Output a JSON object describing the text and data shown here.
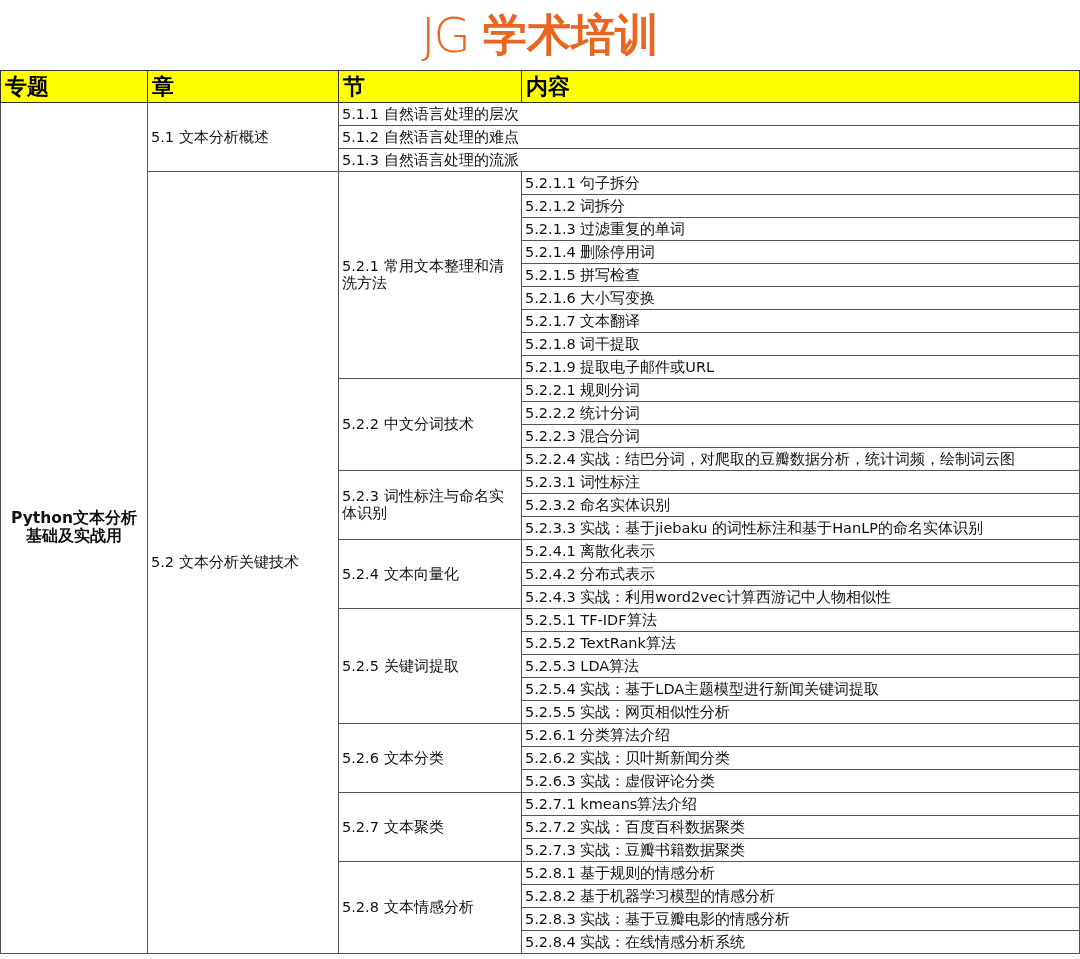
{
  "logo": {
    "mark": "JG",
    "text": "学术培训"
  },
  "table": {
    "columns": [
      "专题",
      "章",
      "节",
      "内容"
    ],
    "topic": "Python文本分析基础及实战用",
    "chapters": [
      {
        "title": "5.1 文本分析概述",
        "children": [
          {
            "title": "5.1.1 自然语言处理的层次"
          },
          {
            "title": "5.1.2 自然语言处理的难点"
          },
          {
            "title": "5.1.3 自然语言处理的流派"
          }
        ]
      },
      {
        "title": "5.2 文本分析关键技术",
        "children": [
          {
            "title": "5.2.1 常用文本整理和清洗方法",
            "children": [
              "5.2.1.1 句子拆分",
              "5.2.1.2 词拆分",
              "5.2.1.3 过滤重复的单词",
              "5.2.1.4 删除停用词",
              "5.2.1.5 拼写检查",
              "5.2.1.6 大小写变换",
              "5.2.1.7 文本翻译",
              "5.2.1.8 词干提取",
              "5.2.1.9 提取电子邮件或URL"
            ]
          },
          {
            "title": "5.2.2 中文分词技术",
            "children": [
              "5.2.2.1 规则分词",
              "5.2.2.2 统计分词",
              "5.2.2.3 混合分词",
              "5.2.2.4 实战：结巴分词，对爬取的豆瓣数据分析，统计词频，绘制词云图"
            ]
          },
          {
            "title": "5.2.3 词性标注与命名实体识别",
            "children": [
              "5.2.3.1 词性标注",
              "5.2.3.2 命名实体识别",
              "5.2.3.3 实战：基于jiebaku 的词性标注和基于HanLP的命名实体识别"
            ]
          },
          {
            "title": "5.2.4 文本向量化",
            "children": [
              "5.2.4.1 离散化表示",
              "5.2.4.2 分布式表示",
              "5.2.4.3 实战：利用word2vec计算西游记中人物相似性"
            ]
          },
          {
            "title": "5.2.5 关键词提取",
            "children": [
              "5.2.5.1 TF-IDF算法",
              "5.2.5.2 TextRank算法",
              "5.2.5.3 LDA算法",
              "5.2.5.4 实战：基于LDA主题模型进行新闻关键词提取",
              "5.2.5.5 实战：网页相似性分析"
            ]
          },
          {
            "title": "5.2.6 文本分类",
            "children": [
              "5.2.6.1 分类算法介绍",
              "5.2.6.2 实战：贝叶斯新闻分类",
              "5.2.6.3 实战：虚假评论分类"
            ]
          },
          {
            "title": "5.2.7 文本聚类",
            "children": [
              "5.2.7.1 kmeans算法介绍",
              "5.2.7.2 实战：百度百科数据聚类",
              "5.2.7.3 实战：豆瓣书籍数据聚类"
            ]
          },
          {
            "title": "5.2.8 文本情感分析",
            "children": [
              "5.2.8.1 基于规则的情感分析",
              "5.2.8.2 基于机器学习模型的情感分析",
              "5.2.8.3 实战：基于豆瓣电影的情感分析",
              "5.2.8.4 实战：在线情感分析系统"
            ]
          }
        ]
      }
    ]
  }
}
